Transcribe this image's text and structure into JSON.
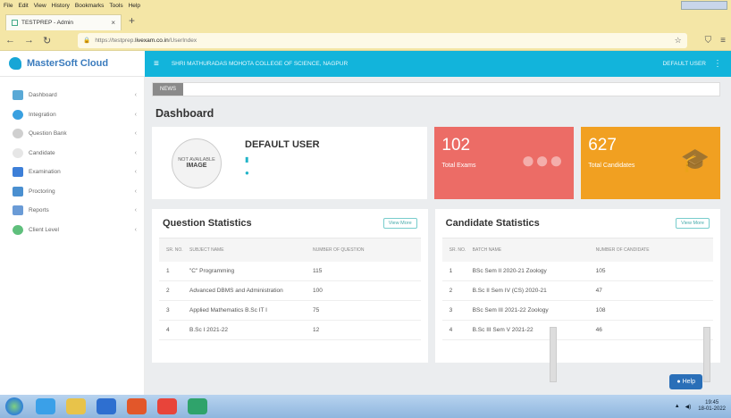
{
  "browser": {
    "menu": [
      "File",
      "Edit",
      "View",
      "History",
      "Bookmarks",
      "Tools",
      "Help"
    ],
    "tab_title": "TESTPREP - Admin",
    "url_prefix": "https://testprep.",
    "url_host": "livexam.co.in",
    "url_path": "/UserIndex"
  },
  "app": {
    "brand": "MasterSoft Cloud",
    "college": "SHRI MATHURADAS MOHOTA COLLEGE OF SCIENCE, NAGPUR",
    "user_menu": "DEFAULT USER"
  },
  "sidebar": {
    "items": [
      {
        "label": "Dashboard",
        "color": "#5aa9d6"
      },
      {
        "label": "Integration",
        "color": "#39a0e0"
      },
      {
        "label": "Question Bank",
        "color": "#9a9a9a"
      },
      {
        "label": "Candidate",
        "color": "#bbbbbb"
      },
      {
        "label": "Examination",
        "color": "#3d7fd8"
      },
      {
        "label": "Proctoring",
        "color": "#4a8fd0"
      },
      {
        "label": "Reports",
        "color": "#6a9bd6"
      },
      {
        "label": "Client Level",
        "color": "#5fbf7c"
      }
    ]
  },
  "news_label": "NEWS",
  "dashboard": {
    "title": "Dashboard",
    "profile": {
      "name": "DEFAULT USER",
      "avatar_text_top": "IMAGE",
      "avatar_text_sub": "NOT AVAILABLE"
    },
    "stats": [
      {
        "value": "102",
        "label": "Total Exams",
        "color": "#ec6c66"
      },
      {
        "value": "627",
        "label": "Total Candidates",
        "color": "#f1a021"
      }
    ]
  },
  "question_stats": {
    "title": "Question Statistics",
    "view_more": "View More",
    "headers": [
      "SR. NO.",
      "SUBJECT NAME",
      "NUMBER OF QUESTION"
    ],
    "rows": [
      {
        "no": "1",
        "name": "\"C\" Programming",
        "count": "115"
      },
      {
        "no": "2",
        "name": "Advanced DBMS and Administration",
        "count": "100"
      },
      {
        "no": "3",
        "name": "Applied Mathematics B.Sc IT I",
        "count": "75"
      },
      {
        "no": "4",
        "name": "B.Sc I 2021-22",
        "count": "12"
      }
    ]
  },
  "candidate_stats": {
    "title": "Candidate Statistics",
    "view_more": "View More",
    "headers": [
      "SR. NO.",
      "BATCH NAME",
      "NUMBER OF CANDIDATE"
    ],
    "rows": [
      {
        "no": "1",
        "name": "BSc Sem II 2020-21 Zoology",
        "count": "105"
      },
      {
        "no": "2",
        "name": "B.Sc II Sem IV (CS) 2020-21",
        "count": "47"
      },
      {
        "no": "3",
        "name": "BSc Sem III 2021-22 Zoology",
        "count": "108"
      },
      {
        "no": "4",
        "name": "B.Sc III Sem V 2021-22",
        "count": "46"
      }
    ]
  },
  "help_label": "Help",
  "taskbar": {
    "time": "19:45",
    "date": "18-01-2022"
  }
}
